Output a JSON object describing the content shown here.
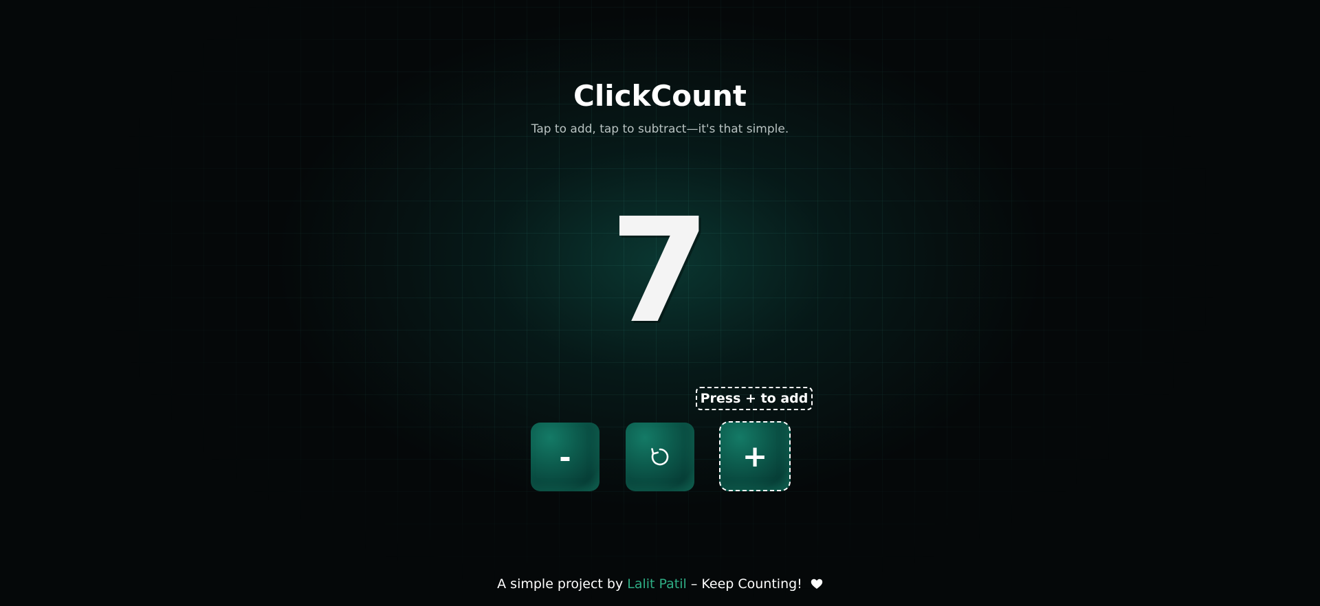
{
  "app": {
    "title": "ClickCount",
    "subtitle": "Tap to add, tap to subtract—it's that simple."
  },
  "counter": {
    "value": "7"
  },
  "hint": {
    "text": "Press + to add"
  },
  "controls": {
    "decrement_label": "-",
    "reset_icon": "reset-icon",
    "increment_label": "+"
  },
  "footer": {
    "prefix": "A simple project by ",
    "author": "Lalit Patil",
    "suffix": " – Keep Counting! ",
    "heart_icon": "heart-icon"
  },
  "colors": {
    "background": "#050809",
    "accent": "#0c5a4c",
    "link": "#2fae85",
    "text": "#ffffff",
    "muted_text": "#b9c3c2"
  }
}
